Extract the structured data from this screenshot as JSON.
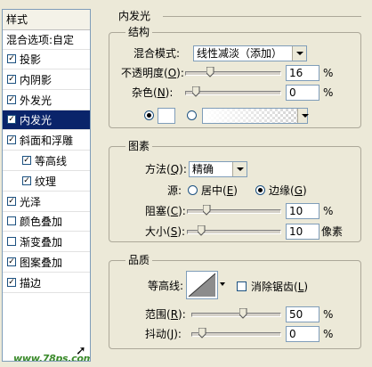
{
  "sidebar": {
    "header": "样式",
    "blend_options": "混合选项:自定",
    "items": [
      {
        "label": "投影",
        "checked": true
      },
      {
        "label": "内阴影",
        "checked": true
      },
      {
        "label": "外发光",
        "checked": true
      },
      {
        "label": "内发光",
        "checked": true,
        "selected": true
      },
      {
        "label": "斜面和浮雕",
        "checked": true
      },
      {
        "label": "等高线",
        "checked": true,
        "sub": true
      },
      {
        "label": "纹理",
        "checked": true,
        "sub": true
      },
      {
        "label": "光泽",
        "checked": true
      },
      {
        "label": "颜色叠加",
        "checked": false
      },
      {
        "label": "渐变叠加",
        "checked": false
      },
      {
        "label": "图案叠加",
        "checked": true
      },
      {
        "label": "描边",
        "checked": true
      }
    ],
    "watermark": "www.78ps.com",
    "check_mark": "✓"
  },
  "panel": {
    "title": "内发光",
    "structure": {
      "title": "结构",
      "blend_mode_label": "混合模式:",
      "blend_mode_value": "线性减淡（添加）",
      "opacity_label": "不透明度(O):",
      "opacity_label_pre": "不透明度(",
      "opacity_label_key": "O",
      "opacity_label_post": "):",
      "opacity_value": "16",
      "opacity_unit": "%",
      "opacity_fraction": 0.16,
      "noise_label_pre": "杂色(",
      "noise_label_key": "N",
      "noise_label_post": "):",
      "noise_value": "0",
      "noise_unit": "%",
      "noise_fraction": 0.0,
      "color_mode": "solid"
    },
    "elements": {
      "title": "图素",
      "method_label_pre": "方法(",
      "method_label_key": "Q",
      "method_label_post": "):",
      "method_value": "精确",
      "source_label": "源:",
      "source_center_pre": "居中(",
      "source_center_key": "E",
      "source_center_post": ")",
      "source_edge_pre": "边缘(",
      "source_edge_key": "G",
      "source_edge_post": ")",
      "source_selected": "edge",
      "choke_label_pre": "阻塞(",
      "choke_label_key": "C",
      "choke_label_post": "):",
      "choke_value": "10",
      "choke_unit": "%",
      "choke_fraction": 0.1,
      "size_label_pre": "大小(",
      "size_label_key": "S",
      "size_label_post": "):",
      "size_value": "10",
      "size_unit": "像素",
      "size_fraction": 0.04
    },
    "quality": {
      "title": "品质",
      "contour_label": "等高线:",
      "antialias_pre": "消除锯齿(",
      "antialias_key": "L",
      "antialias_post": ")",
      "antialias_checked": false,
      "range_label_pre": "范围(",
      "range_label_key": "R",
      "range_label_post": "):",
      "range_value": "50",
      "range_unit": "%",
      "range_fraction": 0.5,
      "jitter_label_pre": "抖动(",
      "jitter_label_key": "J",
      "jitter_label_post": "):",
      "jitter_value": "0",
      "jitter_unit": "%",
      "jitter_fraction": 0.0
    }
  }
}
